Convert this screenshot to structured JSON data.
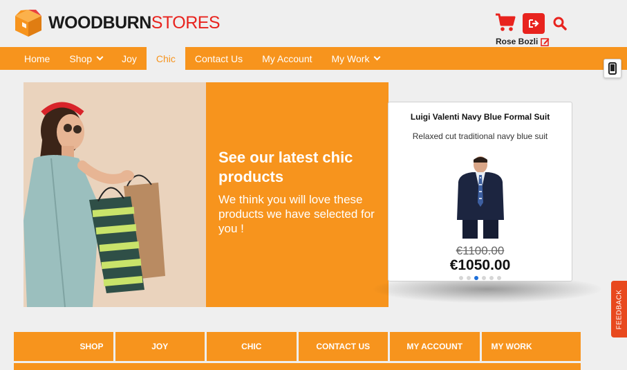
{
  "brand": {
    "name_bold": "WOODBURN",
    "name_light": "STORES",
    "accent": "#f7941d",
    "red": "#e8231e"
  },
  "header": {
    "user_name": "Rose Bozli",
    "icons": [
      "cart-icon",
      "logout-icon",
      "search-icon",
      "edit-icon"
    ]
  },
  "nav": {
    "items": [
      {
        "label": "Home"
      },
      {
        "label": "Shop"
      },
      {
        "label": "Joy"
      },
      {
        "label": "Chic"
      },
      {
        "label": "Contact Us"
      },
      {
        "label": "My Account"
      },
      {
        "label": "My Work"
      }
    ],
    "active": "Chic"
  },
  "hero": {
    "title": "See our latest chic products",
    "subtitle": "We think you will love these products we have selected for you !"
  },
  "product": {
    "name": "Luigi Valenti Navy Blue Formal Suit",
    "description": "Relaxed cut traditional navy blue suit",
    "old_price": "€1100.00",
    "new_price": "€1050.00",
    "carousel_dots": 6,
    "active_dot": 3
  },
  "feedback": {
    "label": "FEEDBACK"
  },
  "bottom_tabs": [
    "SHOP",
    "JOY",
    "CHIC",
    "CONTACT US",
    "MY ACCOUNT",
    "MY WORK"
  ]
}
